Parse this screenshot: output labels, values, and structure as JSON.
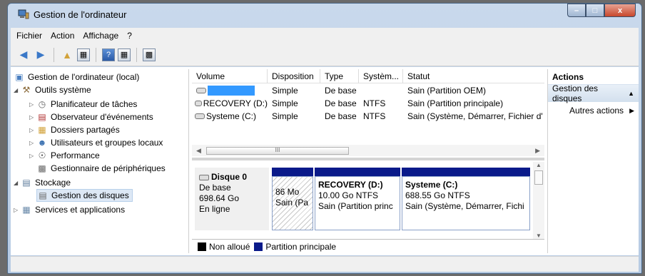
{
  "window": {
    "title": "Gestion de l'ordinateur",
    "controls": {
      "minimize": "–",
      "maximize": "□",
      "close": "x"
    }
  },
  "menu": [
    "Fichier",
    "Action",
    "Affichage",
    "?"
  ],
  "tree": {
    "root": "Gestion de l'ordinateur (local)",
    "outils": "Outils système",
    "planificateur": "Planificateur de tâches",
    "observateur": "Observateur d'événements",
    "dossiers": "Dossiers partagés",
    "utilisateurs": "Utilisateurs et groupes locaux",
    "performance": "Performance",
    "peripheriques": "Gestionnaire de périphériques",
    "stockage": "Stockage",
    "gestion_disques": "Gestion des disques",
    "services": "Services et applications"
  },
  "volumes": {
    "columns": [
      "Volume",
      "Disposition",
      "Type",
      "Systèm...",
      "Statut"
    ],
    "rows": [
      [
        "",
        "Simple",
        "De base",
        "",
        "Sain (Partition OEM)"
      ],
      [
        "RECOVERY (D:)",
        "Simple",
        "De base",
        "NTFS",
        "Sain (Partition principale)"
      ],
      [
        "Systeme (C:)",
        "Simple",
        "De base",
        "NTFS",
        "Sain (Système, Démarrer, Fichier d'"
      ]
    ],
    "hscroll_thumb": "III"
  },
  "disk": {
    "name": "Disque 0",
    "type": "De base",
    "size": "698.64 Go",
    "state": "En ligne",
    "partitions": [
      {
        "name": "",
        "size": "86 Mo",
        "status": "Sain (Pa"
      },
      {
        "name": "RECOVERY  (D:)",
        "size": "10.00 Go NTFS",
        "status": "Sain (Partition princ"
      },
      {
        "name": "Systeme  (C:)",
        "size": "688.55 Go NTFS",
        "status": "Sain (Système, Démarrer, Fichi"
      }
    ]
  },
  "legend": {
    "unallocated": "Non alloué",
    "primary": "Partition principale",
    "unallocated_color": "#000000",
    "primary_color": "#0a1a8a"
  },
  "actions": {
    "title": "Actions",
    "section": "Gestion des disques",
    "more": "Autres actions"
  }
}
